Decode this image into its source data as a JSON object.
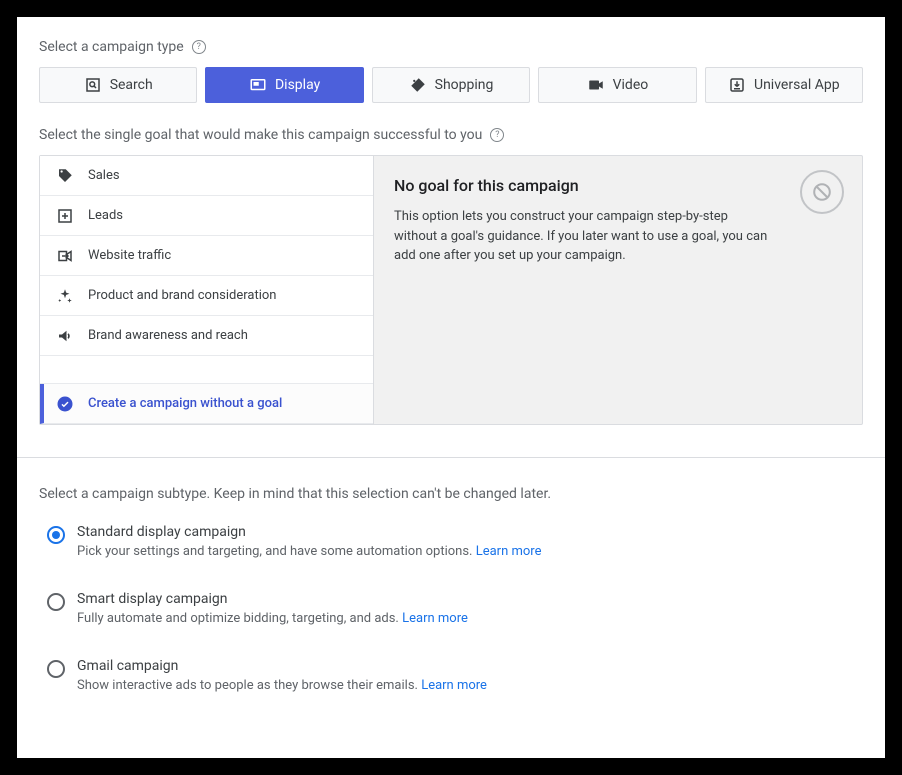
{
  "labels": {
    "campaign_type": "Select a campaign type",
    "goal": "Select the single goal that would make this campaign successful to you",
    "subtype": "Select a campaign subtype. Keep in mind that this selection can't be changed later."
  },
  "tabs": {
    "search": "Search",
    "display": "Display",
    "shopping": "Shopping",
    "video": "Video",
    "universal": "Universal App"
  },
  "goals": {
    "sales": "Sales",
    "leads": "Leads",
    "traffic": "Website traffic",
    "consideration": "Product and brand consideration",
    "awareness": "Brand awareness and reach",
    "no_goal": "Create a campaign without a goal"
  },
  "goal_desc": {
    "title": "No goal for this campaign",
    "body": "This option lets you construct your campaign step-by-step without a goal's guidance. If you later  want to use a goal, you can add one after you set up your campaign."
  },
  "subtypes": {
    "standard": {
      "title": "Standard display campaign",
      "desc": "Pick your settings and targeting, and have some automation options.",
      "learn": "Learn more"
    },
    "smart": {
      "title": "Smart display campaign",
      "desc": "Fully automate and optimize bidding, targeting, and ads.",
      "learn": "Learn more"
    },
    "gmail": {
      "title": "Gmail campaign",
      "desc": "Show interactive ads to people as they browse their emails.",
      "learn": "Learn more"
    }
  }
}
